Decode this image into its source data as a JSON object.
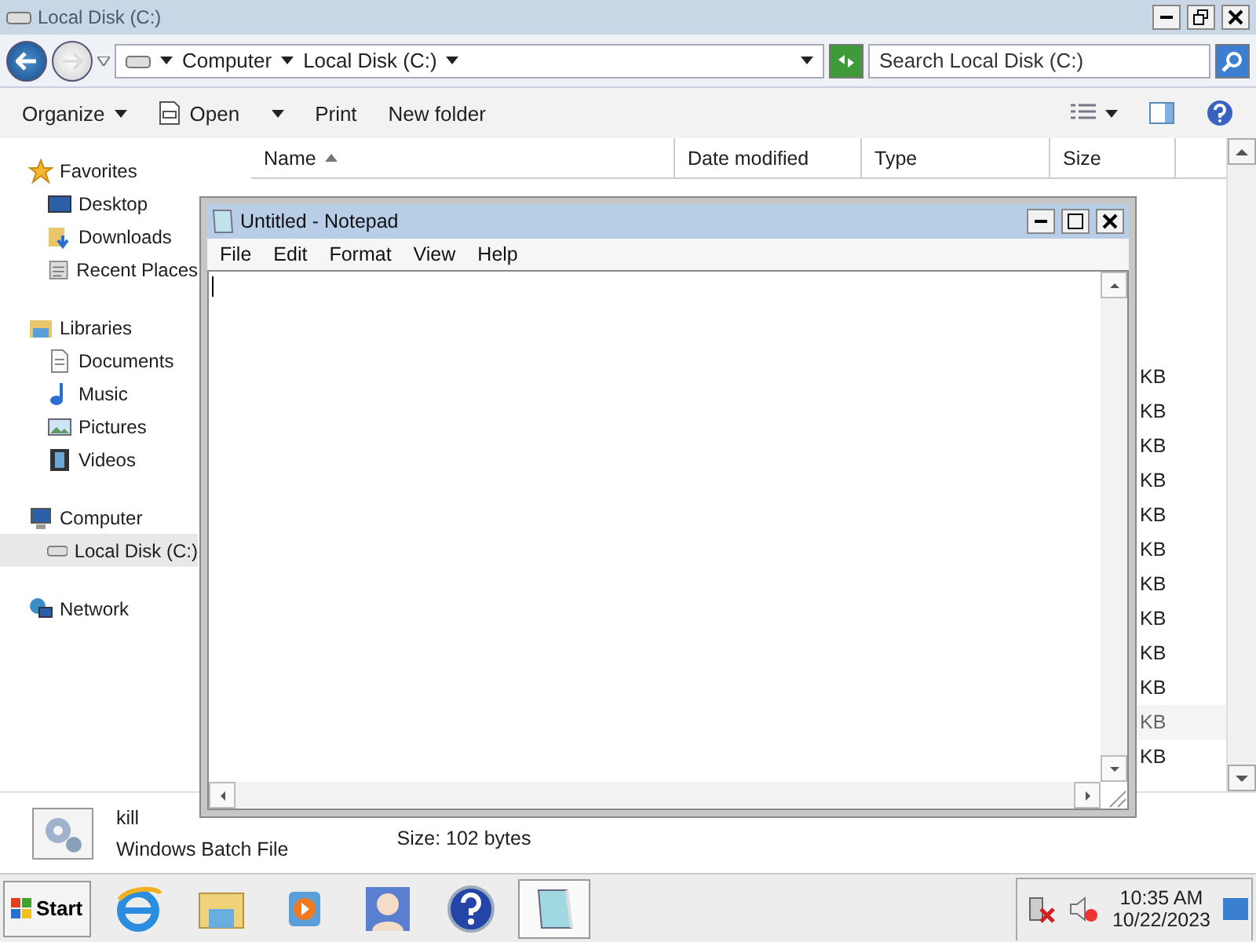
{
  "explorer": {
    "title": "Local Disk (C:)",
    "breadcrumbs": [
      "Computer",
      "Local Disk (C:)"
    ],
    "search": {
      "placeholder": "Search Local Disk (C:)"
    },
    "toolbar": [
      {
        "label": "Organize",
        "kind": "menu"
      },
      {
        "label": "Open",
        "kind": "split"
      },
      {
        "label": "Print",
        "kind": "plain"
      },
      {
        "label": "New folder",
        "kind": "plain"
      }
    ],
    "nav": [
      {
        "label": "Favorites",
        "kind": "star",
        "selected": false,
        "children": [
          {
            "label": "Desktop",
            "kind": "desktop",
            "selected": false
          },
          {
            "label": "Downloads",
            "kind": "downloads",
            "selected": false
          },
          {
            "label": "Recent Places",
            "kind": "recent",
            "selected": false
          }
        ]
      },
      {
        "label": "Libraries",
        "kind": "libraries",
        "selected": false,
        "children": [
          {
            "label": "Documents",
            "kind": "documents",
            "selected": false
          },
          {
            "label": "Music",
            "kind": "music",
            "selected": false
          },
          {
            "label": "Pictures",
            "kind": "pictures",
            "selected": false
          },
          {
            "label": "Videos",
            "kind": "videos",
            "selected": false
          }
        ]
      },
      {
        "label": "Computer",
        "kind": "computer",
        "selected": false,
        "children": [
          {
            "label": "Local Disk (C:)",
            "kind": "disk",
            "selected": true
          }
        ]
      },
      {
        "label": "Network",
        "kind": "network",
        "selected": false
      }
    ],
    "columns": [
      {
        "label": "Name",
        "sorted": true
      },
      {
        "label": "Date modified",
        "sorted": false
      },
      {
        "label": "Type",
        "sorted": false
      },
      {
        "label": "Size",
        "sorted": false
      }
    ],
    "rows": [
      {
        "size": "KB",
        "selected": false
      },
      {
        "size": "KB",
        "selected": false
      },
      {
        "size": "KB",
        "selected": false
      },
      {
        "size": "KB",
        "selected": false
      },
      {
        "size": "KB",
        "selected": false
      },
      {
        "size": "KB",
        "selected": false
      },
      {
        "size": "KB",
        "selected": false
      },
      {
        "size": "KB",
        "selected": false
      },
      {
        "size": "KB",
        "selected": false
      },
      {
        "size": "KB",
        "selected": false
      },
      {
        "size": "KB",
        "selected": true
      },
      {
        "size": "KB",
        "selected": false
      }
    ],
    "details": {
      "name": "kill",
      "type": "Windows Batch File",
      "size": "Size: 102 bytes"
    }
  },
  "notepad": {
    "title": "Untitled - Notepad",
    "menu": [
      "File",
      "Edit",
      "Format",
      "View",
      "Help"
    ]
  },
  "taskbar": {
    "start": "Start",
    "apps": [
      {
        "kind": "browser",
        "selected": false
      },
      {
        "kind": "folder",
        "selected": false
      },
      {
        "kind": "media",
        "selected": false
      },
      {
        "kind": "avatar",
        "selected": false
      },
      {
        "kind": "help",
        "selected": false
      },
      {
        "kind": "notepad",
        "selected": true
      }
    ],
    "time": "10:35 AM",
    "date": "10/22/2023"
  }
}
